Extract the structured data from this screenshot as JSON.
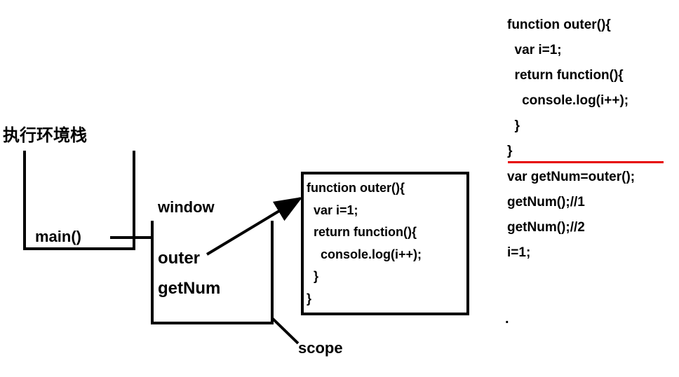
{
  "title": "执行环境栈",
  "stack": {
    "main_label": "main()",
    "scope_items": {
      "window": "window",
      "outer": "outer",
      "getNum": "getNum"
    },
    "scope_label": "scope"
  },
  "function_code": {
    "lines": [
      "function outer(){",
      "  var i=1;",
      "  return function(){",
      "    console.log(i++);",
      "  }",
      "}"
    ]
  },
  "right_code": {
    "lines": [
      "function outer(){",
      "  var i=1;",
      "  return function(){",
      "    console.log(i++);",
      "  }",
      "}",
      "var getNum=outer();",
      "getNum();//1",
      "getNum();//2",
      "i=1;"
    ]
  },
  "dot": "."
}
